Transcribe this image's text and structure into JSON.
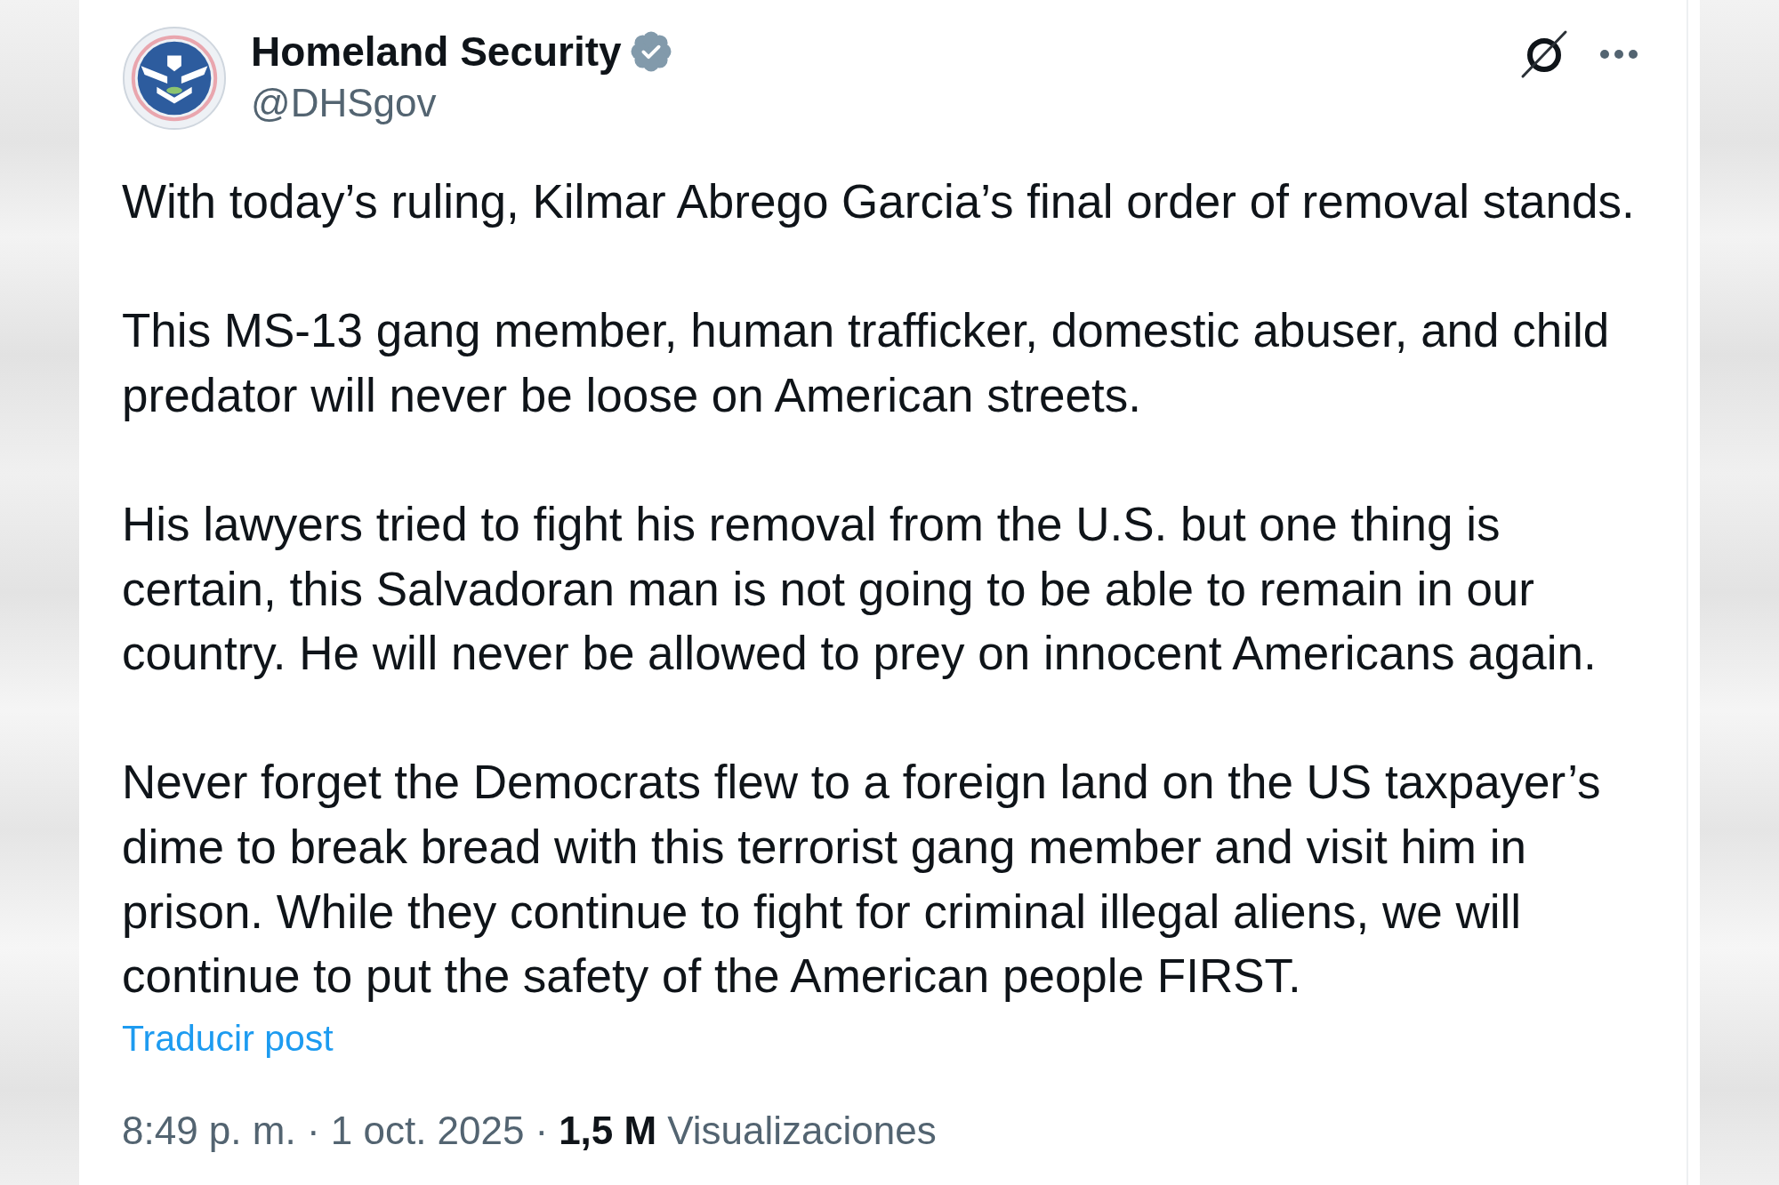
{
  "author": {
    "name": "Homeland Security",
    "verified": true,
    "handle": "@DHSgov"
  },
  "post": {
    "paragraphs": [
      "With today’s ruling, Kilmar Abrego Garcia’s final order of removal stands.",
      "This MS-13 gang member, human trafficker, domestic abuser, and child predator will never be loose on American streets.",
      "His lawyers tried to fight his removal from the U.S. but one thing is certain, this Salvadoran man is not going to be able to remain in our country. He will never be allowed to prey on innocent Americans again.",
      "Never forget the Democrats flew to a foreign land on the US taxpayer’s dime to break bread with this terrorist gang member and visit him in prison. While they continue to fight for criminal illegal aliens, we will continue to put the safety of the American people FIRST."
    ],
    "translate_link": "Traducir post"
  },
  "footer": {
    "timestamp": "8:49 p. m. · 1 oct. 2025",
    "separator": "·",
    "views_count": "1,5 M",
    "views_label": "Visualizaciones"
  }
}
